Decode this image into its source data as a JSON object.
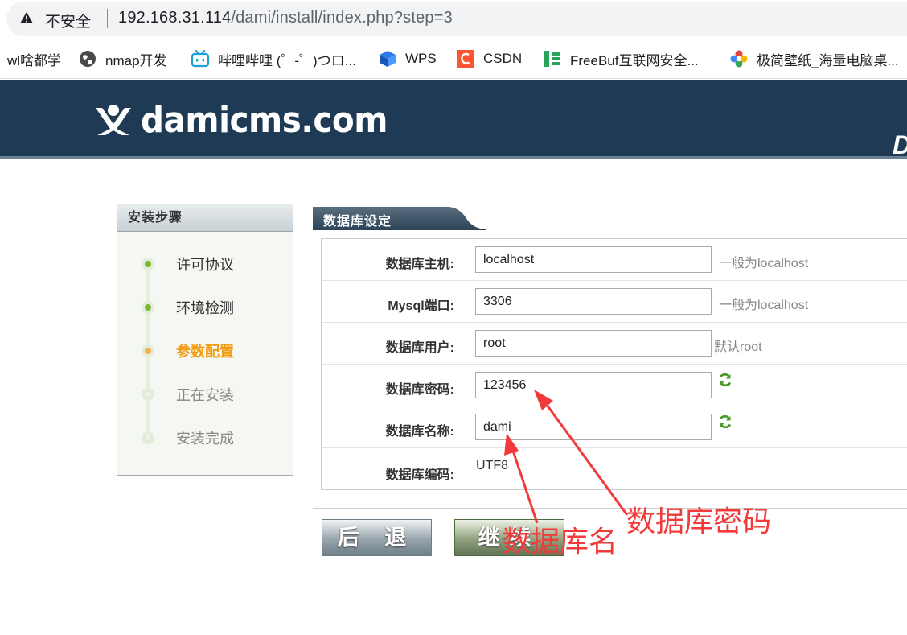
{
  "browser": {
    "security_label": "不安全",
    "url_host": "192.168.31.114",
    "url_path": "/dami/install/index.php?step=3",
    "bookmarks": [
      {
        "label": "wl啥都学",
        "icon": "none"
      },
      {
        "label": "nmap开发",
        "icon": "globe-icon"
      },
      {
        "label": "哔哩哔哩 (゜-゜)つロ...",
        "icon": "bilibili-icon"
      },
      {
        "label": "WPS",
        "icon": "wps-icon"
      },
      {
        "label": "CSDN",
        "icon": "csdn-icon"
      },
      {
        "label": "FreeBuf互联网安全...",
        "icon": "freebuf-icon"
      },
      {
        "label": "极简壁纸_海量电脑桌...",
        "icon": "wallpaper-icon"
      }
    ]
  },
  "header": {
    "logo_text": "damicms.com",
    "edge_letter": "D"
  },
  "steps": {
    "title": "安装步骤",
    "items": [
      {
        "label": "许可协议",
        "state": "done"
      },
      {
        "label": "环境检测",
        "state": "done"
      },
      {
        "label": "参数配置",
        "state": "active"
      },
      {
        "label": "正在安装",
        "state": "pending"
      },
      {
        "label": "安装完成",
        "state": "pending"
      }
    ]
  },
  "form": {
    "title": "数据库设定",
    "rows": [
      {
        "label": "数据库主机:",
        "value": "localhost",
        "hint": "一般为localhost"
      },
      {
        "label": "Mysql端口:",
        "value": "3306",
        "hint": "一般为localhost"
      },
      {
        "label": "数据库用户:",
        "value": "root",
        "hint": "默认root"
      },
      {
        "label": "数据库密码:",
        "value": "123456"
      },
      {
        "label": "数据库名称:",
        "value": "dami"
      },
      {
        "label": "数据库编码:",
        "value": "UTF8"
      }
    ]
  },
  "buttons": {
    "back": "后 退",
    "next": "继续"
  },
  "annotations": {
    "db_name": "数据库名",
    "db_password": "数据库密码"
  },
  "colors": {
    "header_bg": "#1f3a54",
    "step_done": "#7cb82f",
    "step_active": "#f39c12",
    "annotation": "#f33a3a"
  }
}
